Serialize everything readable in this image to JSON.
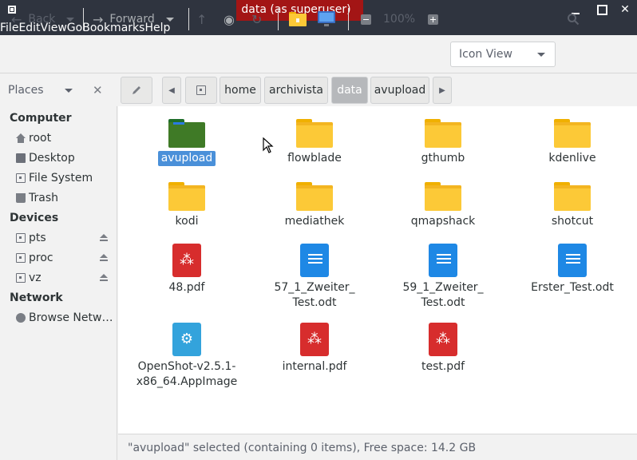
{
  "window": {
    "title": "data (as superuser)"
  },
  "menubar": {
    "items": [
      "File",
      "Edit",
      "View",
      "Go",
      "Bookmarks",
      "Help"
    ]
  },
  "toolbar": {
    "back_label": "Back",
    "forward_label": "Forward",
    "zoom_level": "100%",
    "view_mode": "Icon View"
  },
  "sidebar": {
    "header_label": "Places",
    "sections": [
      {
        "heading": "Computer",
        "items": [
          "root",
          "Desktop",
          "File System",
          "Trash"
        ]
      },
      {
        "heading": "Devices",
        "items": [
          "pts",
          "proc",
          "vz"
        ]
      },
      {
        "heading": "Network",
        "items": [
          "Browse Netw…"
        ]
      }
    ]
  },
  "pathbar": {
    "segments": [
      "home",
      "archivista",
      "data",
      "avupload"
    ],
    "active": "data"
  },
  "files": [
    {
      "name": "avupload",
      "type": "folder",
      "selected": true
    },
    {
      "name": "flowblade",
      "type": "folder"
    },
    {
      "name": "gthumb",
      "type": "folder"
    },
    {
      "name": "kdenlive",
      "type": "folder"
    },
    {
      "name": "kodi",
      "type": "folder"
    },
    {
      "name": "mediathek",
      "type": "folder"
    },
    {
      "name": "qmapshack",
      "type": "folder"
    },
    {
      "name": "shotcut",
      "type": "folder"
    },
    {
      "name": "48.pdf",
      "type": "pdf"
    },
    {
      "name_line1": "57_1_Zweiter_",
      "name_line2": "Test.odt",
      "type": "odt"
    },
    {
      "name_line1": "59_1_Zweiter_",
      "name_line2": "Test.odt",
      "type": "odt"
    },
    {
      "name": "Erster_Test.odt",
      "type": "odt"
    },
    {
      "name_line1": "OpenShot-v2.5.1-",
      "name_line2": "x86_64.AppImage",
      "type": "appimage"
    },
    {
      "name": "internal.pdf",
      "type": "pdf"
    },
    {
      "name": "test.pdf",
      "type": "pdf"
    }
  ],
  "status": {
    "text": "\"avupload\" selected (containing 0 items), Free space: 14.2 GB"
  },
  "colors": {
    "titlebar": "#2f343f",
    "title_badge": "#a31515",
    "selection": "#4a90d9",
    "folder_yellow": "#fcc937",
    "folder_green": "#3f7a26",
    "pdf_red": "#d72d2d",
    "odt_blue": "#1e88e5"
  }
}
